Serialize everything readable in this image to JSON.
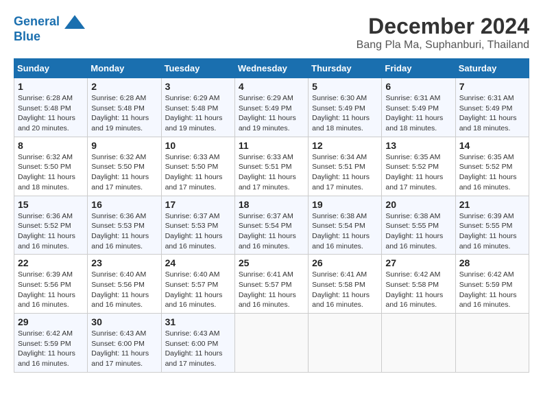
{
  "header": {
    "logo_line1": "General",
    "logo_line2": "Blue",
    "month_title": "December 2024",
    "location": "Bang Pla Ma, Suphanburi, Thailand"
  },
  "columns": [
    "Sunday",
    "Monday",
    "Tuesday",
    "Wednesday",
    "Thursday",
    "Friday",
    "Saturday"
  ],
  "weeks": [
    [
      {
        "day": "1",
        "sunrise": "6:28 AM",
        "sunset": "5:48 PM",
        "daylight": "11 hours and 20 minutes."
      },
      {
        "day": "2",
        "sunrise": "6:28 AM",
        "sunset": "5:48 PM",
        "daylight": "11 hours and 19 minutes."
      },
      {
        "day": "3",
        "sunrise": "6:29 AM",
        "sunset": "5:48 PM",
        "daylight": "11 hours and 19 minutes."
      },
      {
        "day": "4",
        "sunrise": "6:29 AM",
        "sunset": "5:49 PM",
        "daylight": "11 hours and 19 minutes."
      },
      {
        "day": "5",
        "sunrise": "6:30 AM",
        "sunset": "5:49 PM",
        "daylight": "11 hours and 18 minutes."
      },
      {
        "day": "6",
        "sunrise": "6:31 AM",
        "sunset": "5:49 PM",
        "daylight": "11 hours and 18 minutes."
      },
      {
        "day": "7",
        "sunrise": "6:31 AM",
        "sunset": "5:49 PM",
        "daylight": "11 hours and 18 minutes."
      }
    ],
    [
      {
        "day": "8",
        "sunrise": "6:32 AM",
        "sunset": "5:50 PM",
        "daylight": "11 hours and 18 minutes."
      },
      {
        "day": "9",
        "sunrise": "6:32 AM",
        "sunset": "5:50 PM",
        "daylight": "11 hours and 17 minutes."
      },
      {
        "day": "10",
        "sunrise": "6:33 AM",
        "sunset": "5:50 PM",
        "daylight": "11 hours and 17 minutes."
      },
      {
        "day": "11",
        "sunrise": "6:33 AM",
        "sunset": "5:51 PM",
        "daylight": "11 hours and 17 minutes."
      },
      {
        "day": "12",
        "sunrise": "6:34 AM",
        "sunset": "5:51 PM",
        "daylight": "11 hours and 17 minutes."
      },
      {
        "day": "13",
        "sunrise": "6:35 AM",
        "sunset": "5:52 PM",
        "daylight": "11 hours and 17 minutes."
      },
      {
        "day": "14",
        "sunrise": "6:35 AM",
        "sunset": "5:52 PM",
        "daylight": "11 hours and 16 minutes."
      }
    ],
    [
      {
        "day": "15",
        "sunrise": "6:36 AM",
        "sunset": "5:52 PM",
        "daylight": "11 hours and 16 minutes."
      },
      {
        "day": "16",
        "sunrise": "6:36 AM",
        "sunset": "5:53 PM",
        "daylight": "11 hours and 16 minutes."
      },
      {
        "day": "17",
        "sunrise": "6:37 AM",
        "sunset": "5:53 PM",
        "daylight": "11 hours and 16 minutes."
      },
      {
        "day": "18",
        "sunrise": "6:37 AM",
        "sunset": "5:54 PM",
        "daylight": "11 hours and 16 minutes."
      },
      {
        "day": "19",
        "sunrise": "6:38 AM",
        "sunset": "5:54 PM",
        "daylight": "11 hours and 16 minutes."
      },
      {
        "day": "20",
        "sunrise": "6:38 AM",
        "sunset": "5:55 PM",
        "daylight": "11 hours and 16 minutes."
      },
      {
        "day": "21",
        "sunrise": "6:39 AM",
        "sunset": "5:55 PM",
        "daylight": "11 hours and 16 minutes."
      }
    ],
    [
      {
        "day": "22",
        "sunrise": "6:39 AM",
        "sunset": "5:56 PM",
        "daylight": "11 hours and 16 minutes."
      },
      {
        "day": "23",
        "sunrise": "6:40 AM",
        "sunset": "5:56 PM",
        "daylight": "11 hours and 16 minutes."
      },
      {
        "day": "24",
        "sunrise": "6:40 AM",
        "sunset": "5:57 PM",
        "daylight": "11 hours and 16 minutes."
      },
      {
        "day": "25",
        "sunrise": "6:41 AM",
        "sunset": "5:57 PM",
        "daylight": "11 hours and 16 minutes."
      },
      {
        "day": "26",
        "sunrise": "6:41 AM",
        "sunset": "5:58 PM",
        "daylight": "11 hours and 16 minutes."
      },
      {
        "day": "27",
        "sunrise": "6:42 AM",
        "sunset": "5:58 PM",
        "daylight": "11 hours and 16 minutes."
      },
      {
        "day": "28",
        "sunrise": "6:42 AM",
        "sunset": "5:59 PM",
        "daylight": "11 hours and 16 minutes."
      }
    ],
    [
      {
        "day": "29",
        "sunrise": "6:42 AM",
        "sunset": "5:59 PM",
        "daylight": "11 hours and 16 minutes."
      },
      {
        "day": "30",
        "sunrise": "6:43 AM",
        "sunset": "6:00 PM",
        "daylight": "11 hours and 17 minutes."
      },
      {
        "day": "31",
        "sunrise": "6:43 AM",
        "sunset": "6:00 PM",
        "daylight": "11 hours and 17 minutes."
      },
      null,
      null,
      null,
      null
    ]
  ]
}
